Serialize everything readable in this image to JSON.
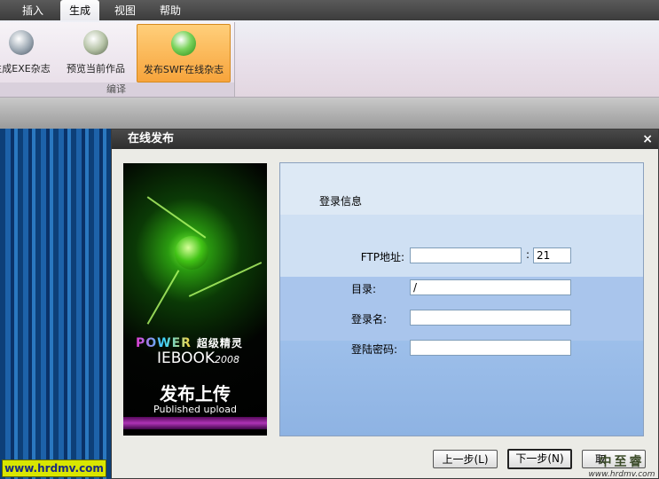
{
  "menu": {
    "items": [
      {
        "label": "插入"
      },
      {
        "label": "生成"
      },
      {
        "label": "视图"
      },
      {
        "label": "帮助"
      }
    ],
    "active_index": 1
  },
  "ribbon": {
    "buttons": [
      {
        "label": "生成EXE杂志"
      },
      {
        "label": "预览当前作品"
      },
      {
        "label": "发布SWF在线杂志"
      }
    ],
    "group_label": "编译"
  },
  "dialog": {
    "title": "在线发布",
    "close_symbol": "×",
    "banner": {
      "power": "POWER",
      "power_cn": "超级精灵",
      "iebook": "IEBOOK",
      "year": "2008",
      "headline": "发布上传",
      "subtitle": "Published upload"
    },
    "section_title": "登录信息",
    "fields": {
      "ftp": {
        "label": "FTP地址:",
        "value": "",
        "port": "21",
        "separator": ":"
      },
      "dir": {
        "label": "目录:",
        "value": "/"
      },
      "username": {
        "label": "登录名:",
        "value": ""
      },
      "password": {
        "label": "登陆密码:",
        "value": ""
      }
    },
    "buttons": {
      "prev": "上一步(L)",
      "next": "下一步(N)",
      "cancel": "取"
    }
  },
  "watermarks": {
    "left": "www.hrdmv.com",
    "right_cn": "中至睿",
    "right_en": "www.hrdmv.com"
  },
  "colors": {
    "accent_orange": "#f7a43c",
    "titlebar": "#2d2d2d",
    "panel_blue": "#a9c5ec"
  }
}
